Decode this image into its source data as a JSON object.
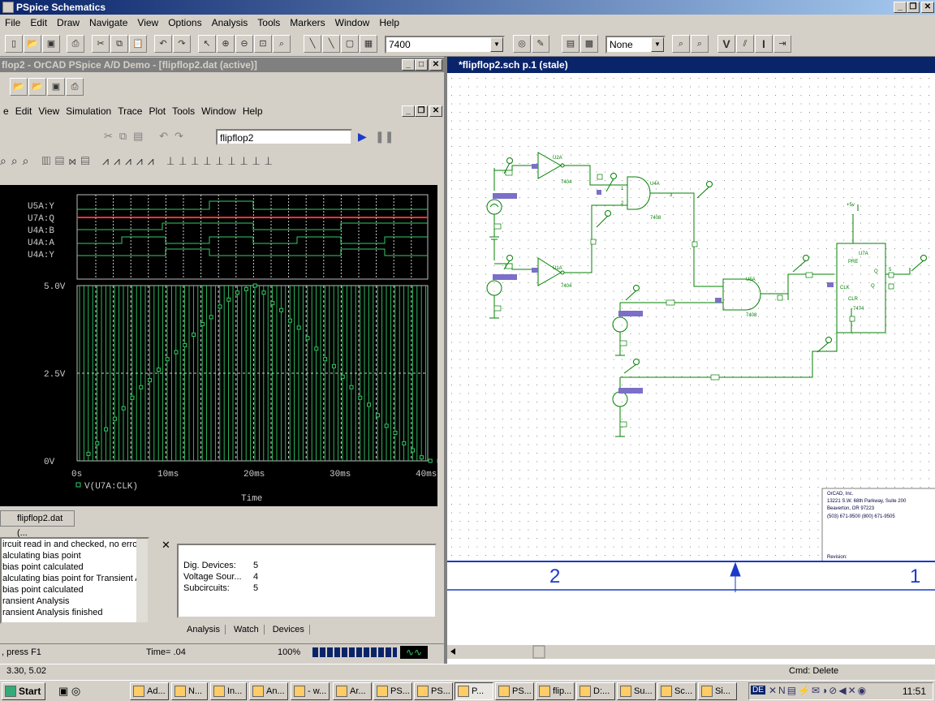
{
  "app": {
    "title": "PSpice Schematics"
  },
  "menu": [
    "File",
    "Edit",
    "Draw",
    "Navigate",
    "View",
    "Options",
    "Analysis",
    "Tools",
    "Markers",
    "Window",
    "Help"
  ],
  "toolbar": {
    "part_combo": "7400",
    "attr_combo": "None",
    "v_label": "V",
    "i_label": "I"
  },
  "probe": {
    "title": "flop2 - OrCAD PSpice A/D Demo  - [flipflop2.dat (active)]",
    "menu": [
      "e",
      "Edit",
      "View",
      "Simulation",
      "Trace",
      "Plot",
      "Tools",
      "Window",
      "Help"
    ],
    "sim_combo": "flipflop2",
    "digital_labels": [
      "U5A:Y",
      "U7A:Q",
      "U4A:B",
      "U4A:A",
      "U4A:Y"
    ],
    "tab_label": "flipflop2.dat (...",
    "time_label": "Time= .04",
    "zoom_label": "100%",
    "hint": ", press F1",
    "log": [
      "ircuit read in and checked, no errors",
      "alculating bias point",
      "bias point calculated",
      "alculating bias point for Transient Ar",
      "bias point calculated",
      "ransient Analysis",
      "ransient Analysis finished"
    ],
    "devices": [
      {
        "label": "Dig. Devices:",
        "value": "5"
      },
      {
        "label": "Voltage Sour...",
        "value": "4"
      },
      {
        "label": "Subcircuits:",
        "value": "5"
      }
    ],
    "tabs": [
      "Analysis",
      "Watch",
      "Devices"
    ]
  },
  "chart_data": {
    "type": "line",
    "series": [
      {
        "name": "V(U7A:CLK)",
        "x_ms": [
          0,
          1,
          2,
          3,
          4,
          5,
          6,
          7,
          8,
          9,
          10,
          11,
          12,
          13,
          14,
          15,
          16,
          17,
          18,
          19,
          20,
          21,
          22,
          23,
          24,
          25,
          26,
          27,
          28,
          29,
          30,
          31,
          32,
          33,
          34,
          35,
          36,
          37,
          38,
          39,
          40
        ],
        "values": [
          0.2,
          0.5,
          0.9,
          1.2,
          1.5,
          1.8,
          2.1,
          2.3,
          2.6,
          2.9,
          3.1,
          3.3,
          3.6,
          3.9,
          4.1,
          4.4,
          4.6,
          4.8,
          4.9,
          5.0,
          4.8,
          4.5,
          4.3,
          4.0,
          3.8,
          3.5,
          3.2,
          2.9,
          2.7,
          2.4,
          2.1,
          1.8,
          1.6,
          1.3,
          1.0,
          0.8,
          0.5,
          0.3,
          0.1,
          0.0,
          0.0
        ]
      }
    ],
    "ylim": [
      0,
      5
    ],
    "yticks": [
      "5.0V",
      "2.5V",
      "0V"
    ],
    "xticks": [
      "0s",
      "10ms",
      "20ms",
      "30ms",
      "40ms"
    ],
    "xlabel": "Time"
  },
  "schematic": {
    "title": "*flipflop2.sch  p.1  (stale)",
    "parts": [
      "U2A",
      "U1A",
      "U4A",
      "U5A",
      "U7A",
      "7404",
      "7404",
      "7408",
      "7408",
      "7474"
    ],
    "pin_labels": [
      "PRE",
      "CLK",
      "CLR",
      "Q",
      "Q",
      "1",
      "2",
      "3",
      "5",
      "6"
    ],
    "supply": "+5v",
    "titleblock": [
      "OrCAD, Inc.",
      "13221 S.W. 68th Parkway, Suite 200",
      "Beaverton, OR 97223",
      "(503) 671-9500   (800) 671-9505",
      "Revision:"
    ],
    "ruler_numbers": [
      "2",
      "1"
    ]
  },
  "status": {
    "coords": "3.30,  5.02",
    "cmd": "Cmd: Delete"
  },
  "taskbar": {
    "start": "Start",
    "tasks": [
      "Ad...",
      "N...",
      "In...",
      "An...",
      "- w...",
      "Ar...",
      "PS...",
      "PS...",
      "P...",
      "PS...",
      "flip...",
      "D:...",
      "Su...",
      "Sc...",
      "Si..."
    ],
    "clock": "11:51",
    "lang": "DE"
  }
}
